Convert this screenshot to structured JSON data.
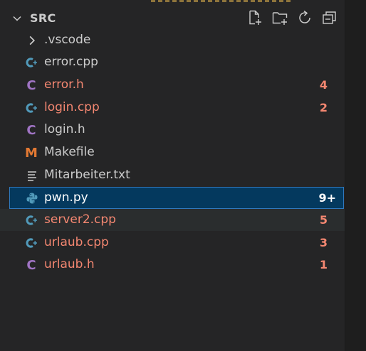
{
  "panel": {
    "title": "SRC"
  },
  "colors": {
    "modified": "#f48771",
    "normal": "#cccccc",
    "selected_text": "#ffffff",
    "selected_bg": "#04395e",
    "cpp_icon": "#519aba",
    "h_icon": "#a074c4",
    "make_icon": "#e37933",
    "py_icon": "#519aba"
  },
  "actions": [
    {
      "name": "new-file-icon"
    },
    {
      "name": "new-folder-icon"
    },
    {
      "name": "refresh-icon"
    },
    {
      "name": "collapse-all-icon"
    }
  ],
  "files": [
    {
      "label": ".vscode",
      "icon": "chevron-right-icon",
      "badge": "",
      "state": "folder"
    },
    {
      "label": "error.cpp",
      "icon": "cpp-icon",
      "badge": "",
      "state": "normal"
    },
    {
      "label": "error.h",
      "icon": "c-header-icon",
      "badge": "4",
      "state": "modified"
    },
    {
      "label": "login.cpp",
      "icon": "cpp-icon",
      "badge": "2",
      "state": "modified"
    },
    {
      "label": "login.h",
      "icon": "c-header-icon",
      "badge": "",
      "state": "normal"
    },
    {
      "label": "Makefile",
      "icon": "makefile-icon",
      "badge": "",
      "state": "normal"
    },
    {
      "label": "Mitarbeiter.txt",
      "icon": "text-file-icon",
      "badge": "",
      "state": "normal"
    },
    {
      "label": "pwn.py",
      "icon": "python-icon",
      "badge": "9+",
      "state": "selected"
    },
    {
      "label": "server2.cpp",
      "icon": "cpp-icon",
      "badge": "5",
      "state": "modified-hover"
    },
    {
      "label": "urlaub.cpp",
      "icon": "cpp-icon",
      "badge": "3",
      "state": "modified"
    },
    {
      "label": "urlaub.h",
      "icon": "c-header-icon",
      "badge": "1",
      "state": "modified"
    }
  ]
}
